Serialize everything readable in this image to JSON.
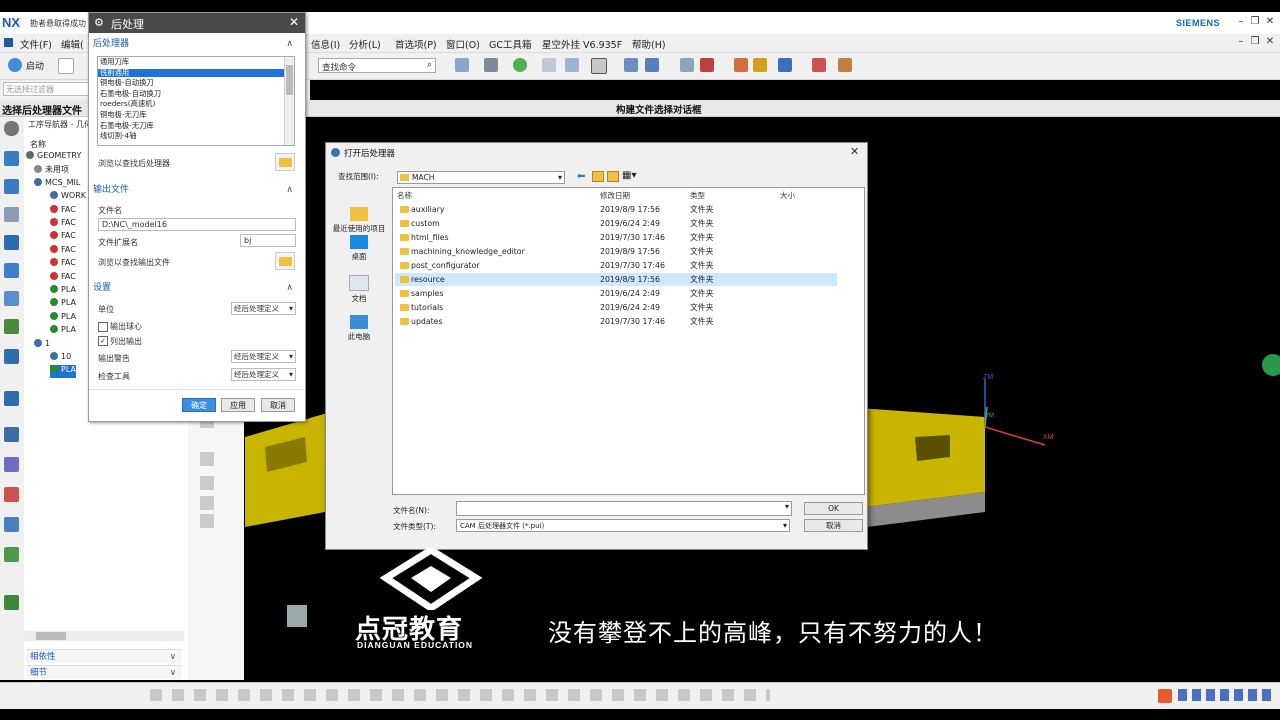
{
  "app": {
    "logo": "NX",
    "title": "勘者悬取得成功",
    "brand": "SIEMENS"
  },
  "menubar": {
    "items_left": [
      "文件(F)",
      "编辑("
    ],
    "items_right": [
      "信息(I)",
      "分析(L)",
      "首选项(P)",
      "窗口(O)",
      "GC工具箱",
      "星空外挂 V6.935F",
      "帮助(H)"
    ]
  },
  "toolbar": {
    "start_label": "启动",
    "search_placeholder": "查找命令"
  },
  "filter": {
    "placeholder": "无选择过滤器"
  },
  "subbar": {
    "left_title": "选择后处理器文件",
    "center_title": "构建文件选择对话框"
  },
  "navigator": {
    "header": "工序导航器 - 几何",
    "column_name": "名称",
    "rows": [
      "GEOMETRY",
      "未用项",
      "MCS_MIL",
      "WORK",
      "FAC",
      "FAC",
      "FAC",
      "FAC",
      "FAC",
      "FAC",
      "PLA",
      "PLA",
      "PLA",
      "PLA",
      "1",
      "10",
      "PLA"
    ],
    "dependency_label": "相依性",
    "detail_label": "细节"
  },
  "post_dialog": {
    "title": "后处理",
    "section_post": "后处理器",
    "post_list": [
      "通用刀库",
      "铣削通用",
      "铜电极-自动换刀",
      "石墨电极-自动换刀",
      "roeders(高速机)",
      "铜电极-无刀库",
      "石墨电极-无刀库",
      "线切割-4轴"
    ],
    "selected_index": 1,
    "browse_post_label": "浏览以查找后处理器",
    "section_output": "输出文件",
    "filename_label": "文件名",
    "filename_value": "D:\\NC\\_model16",
    "ext_label": "文件扩展名",
    "ext_value": "bj",
    "browse_output_label": "浏览以查找输出文件",
    "section_settings": "设置",
    "units_label": "单位",
    "units_value": "经后处理定义",
    "output_ball_center_label": "输出球心",
    "output_ball_center_checked": false,
    "list_output_label": "列出输出",
    "list_output_checked": true,
    "output_warning_label": "输出警告",
    "output_warning_value": "经后处理定义",
    "check_tool_label": "检查工具",
    "check_tool_value": "经后处理定义",
    "ok_label": "确定",
    "apply_label": "应用",
    "cancel_label": "取消"
  },
  "open_dialog": {
    "title": "打开后处理器",
    "lookin_label": "查找范围(I):",
    "lookin_value": "MACH",
    "columns": [
      "名称",
      "修改日期",
      "类型",
      "大小"
    ],
    "places": [
      "最近使用的项目",
      "桌面",
      "文档",
      "此电脑"
    ],
    "files": [
      {
        "name": "auxiliary",
        "date": "2019/8/9 17:56",
        "type": "文件夹"
      },
      {
        "name": "custom",
        "date": "2019/6/24 2:49",
        "type": "文件夹"
      },
      {
        "name": "html_files",
        "date": "2019/7/30 17:46",
        "type": "文件夹"
      },
      {
        "name": "machining_knowledge_editor",
        "date": "2019/8/9 17:56",
        "type": "文件夹"
      },
      {
        "name": "post_configurator",
        "date": "2019/7/30 17:46",
        "type": "文件夹"
      },
      {
        "name": "resource",
        "date": "2019/8/9 17:56",
        "type": "文件夹"
      },
      {
        "name": "samples",
        "date": "2019/6/24 2:49",
        "type": "文件夹"
      },
      {
        "name": "tutorials",
        "date": "2019/6/24 2:49",
        "type": "文件夹"
      },
      {
        "name": "updates",
        "date": "2019/7/30 17:46",
        "type": "文件夹"
      }
    ],
    "highlighted_index": 5,
    "filename_label": "文件名(N):",
    "filename_value": "",
    "filetype_label": "文件类型(T):",
    "filetype_value": "CAM 后处理器文件 (*.pui)",
    "ok_label": "OK",
    "cancel_label": "取消"
  },
  "viewport": {
    "axis_zm": "ZM",
    "axis_ym": "YM",
    "axis_xm": "XM",
    "part_color": "#c9b400"
  },
  "watermark": {
    "brand_cn": "点冠教育",
    "brand_en": "DIANGUAN EDUCATION",
    "slogan": "没有攀登不上的高峰，只有不努力的人！"
  },
  "colors": {
    "accent": "#1c5aa6",
    "selection": "#1e73d8",
    "highlight_row": "#cde8ff",
    "folder": "#f0c040"
  }
}
